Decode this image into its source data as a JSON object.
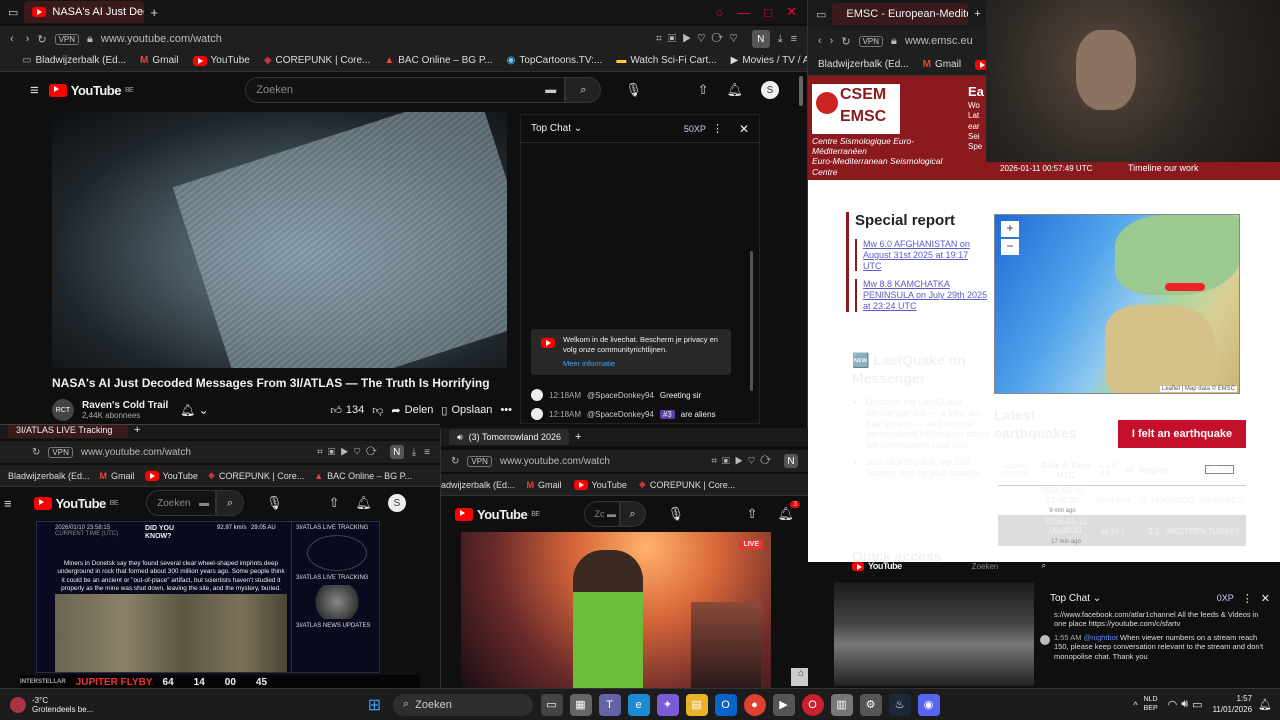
{
  "main_window": {
    "tab_title": "NASA's AI Just Decoded",
    "url": "www.youtube.com/watch",
    "bookmarks": [
      "Bladwijzerbalk (Ed...",
      "Gmail",
      "YouTube",
      "COREPUNK | Core...",
      "BAC Online – BG P...",
      "TopCartoons.TV:...",
      "Watch Sci-Fi Cart...",
      "Movies / TV / Ani..."
    ],
    "yt_brand": "YouTube",
    "yt_region": "BE",
    "search_placeholder": "Zoeken",
    "avatar_letter": "S",
    "video_title": "NASA's AI Just Decoded Messages From 3I/ATLAS — The Truth Is Horrifying",
    "channel_name": "Raven's Cold Trail",
    "subscribers": "2,44K abonnees",
    "likes": "134",
    "share_label": "Delen",
    "save_label": "Opslaan",
    "chat_header": "Top Chat",
    "xp": "50XP",
    "chat_notice": "Welkom in de livechat. Bescherm je privacy en volg onze communityrichtlijnen.",
    "chat_notice_link": "Meer informatie",
    "chat_messages": [
      {
        "time": "12:18AM",
        "user": "@SpaceDonkey94",
        "badge": "",
        "text": "Greeting sir"
      },
      {
        "time": "12:18AM",
        "user": "@SpaceDonkey94",
        "badge": "#3",
        "text": "are aliens"
      }
    ]
  },
  "bottom_left_window": {
    "tab_title": "3I/ATLAS LIVE Tracking",
    "url": "www.youtube.com/watch",
    "bookmarks": [
      "Bladwijzerbalk (Ed...",
      "Gmail",
      "YouTube",
      "COREPUNK | Core...",
      "BAC Online – BG P..."
    ],
    "search_placeholder": "Zoeken",
    "avatar_letter": "S",
    "overlay_time": "2026/01/10 23:58:15",
    "overlay_time_label": "CURRENT TIME (UTC)",
    "did_you_know": "DID YOU KNOW?",
    "fact_text": "Miners in Donetsk say they found several clear wheel-shaped imprints deep underground in rock that formed about 300 million years ago. Some people think it could be an ancient or \"out-of-place\" artifact, but scientists haven't studied it properly as the mine was shut down, leaving the site, and the mystery, buried.",
    "stat_1": "92.97 km/s",
    "stat_2": "29.05 AU",
    "side_labels": [
      "3I/ATLAS LIVE TRACKING",
      "3I/ATLAS LIVE TRACKING",
      "3I/ATLAS NEWS UPDATES"
    ],
    "flyby_label": "JUPITER FLYBY",
    "countdown": [
      "64",
      "14",
      "00",
      "45"
    ]
  },
  "bottom_mid_window": {
    "tab_title": "(3) Tomorrowland 2026",
    "url": "www.youtube.com/watch",
    "bookmarks": [
      "adwijzerbalk (Ed...",
      "Gmail",
      "YouTube",
      "COREPUNK | Core..."
    ],
    "notif_count": "3",
    "live_badge": "LIVE"
  },
  "emsc_window": {
    "tab_title": "EMSC - European-Mediter",
    "url": "www.emsc.eu",
    "bookmarks": [
      "Bladwijzerbalk (Ed...",
      "Gmail"
    ],
    "logo_top": "CSEM",
    "logo_bottom": "EMSC",
    "org_fr": "Centre Sismologique Euro-Méditerranéen",
    "org_en": "Euro-Mediterranean Seismological Centre",
    "datetime": "2026-01-11 00:57:49 UTC",
    "nav": [
      "Timeline",
      "our work"
    ],
    "special_report_title": "Special report",
    "reports": [
      "Mw 6.0 AFGHANISTAN on August 31st 2025 at 19:17 UTC",
      "Mw 8.8 KAMCHATKA PENINSULA on July 29th 2025 at 23:24 UTC"
    ],
    "lastquake_title": "🆕 LastQuake on Messenger",
    "lastquake_items": [
      "Discover the LastQuake Messenger Bot — a free, ad-free service — and receive personalised information about felt earthquakes near you.",
      "Just click this link, tap Get Started, and se your location."
    ],
    "map_zoom_in": "+",
    "map_zoom_out": "−",
    "map_attrib": "Leaflet | Map data © EMSC",
    "latest_title": "Latest earthquakes",
    "felt_button": "I felt an earthquake",
    "table_headers": [
      "Citizen response",
      "Date & Time UTC",
      "L L D d k",
      "M",
      "Region"
    ],
    "filter": "All Mag",
    "quakes": [
      {
        "date": "2026-01-11",
        "time": "01:48:30",
        "ago": "9 min ago",
        "vals": "42.14 60.4",
        "mag": "0",
        "region": "HOKKAIDO, JAPAN REGI..."
      },
      {
        "date": "2026-01-11",
        "time": "00:40:31",
        "ago": "17 min ago",
        "vals": "38.27 2",
        "mag": "2.1",
        "region": "WESTERN TURKEY"
      }
    ],
    "quick_access": "Quick access",
    "header_side": [
      "Ea",
      "Wo",
      "Lat",
      "ear",
      "Sei",
      "Spe"
    ]
  },
  "bottom_right_window": {
    "search_placeholder": "Zoeken",
    "chat_header": "Top Chat",
    "xp": "0XP",
    "msg_link_text": "s://www.facebook.com/atlar1channel All the feeds & Videos in one place https://youtube.com/c/sfartv",
    "bot_time": "1:55 AM",
    "bot_user": "@nightbot",
    "bot_text": "When viewer numbers on a stream reach 150, please keep conversation relevant to the stream and don't monopolise chat. Thank you"
  },
  "taskbar": {
    "weather_temp": "-3°C",
    "weather_desc": "Grotendeels be...",
    "search_label": "Zoeken",
    "lang_1": "NLD",
    "lang_2": "BEP",
    "time": "1:57",
    "date": "11/01/2026"
  },
  "colors": {
    "youtube_red": "#ff0000",
    "emsc_red": "#b22234",
    "taskbar": "#1c1c1c"
  }
}
